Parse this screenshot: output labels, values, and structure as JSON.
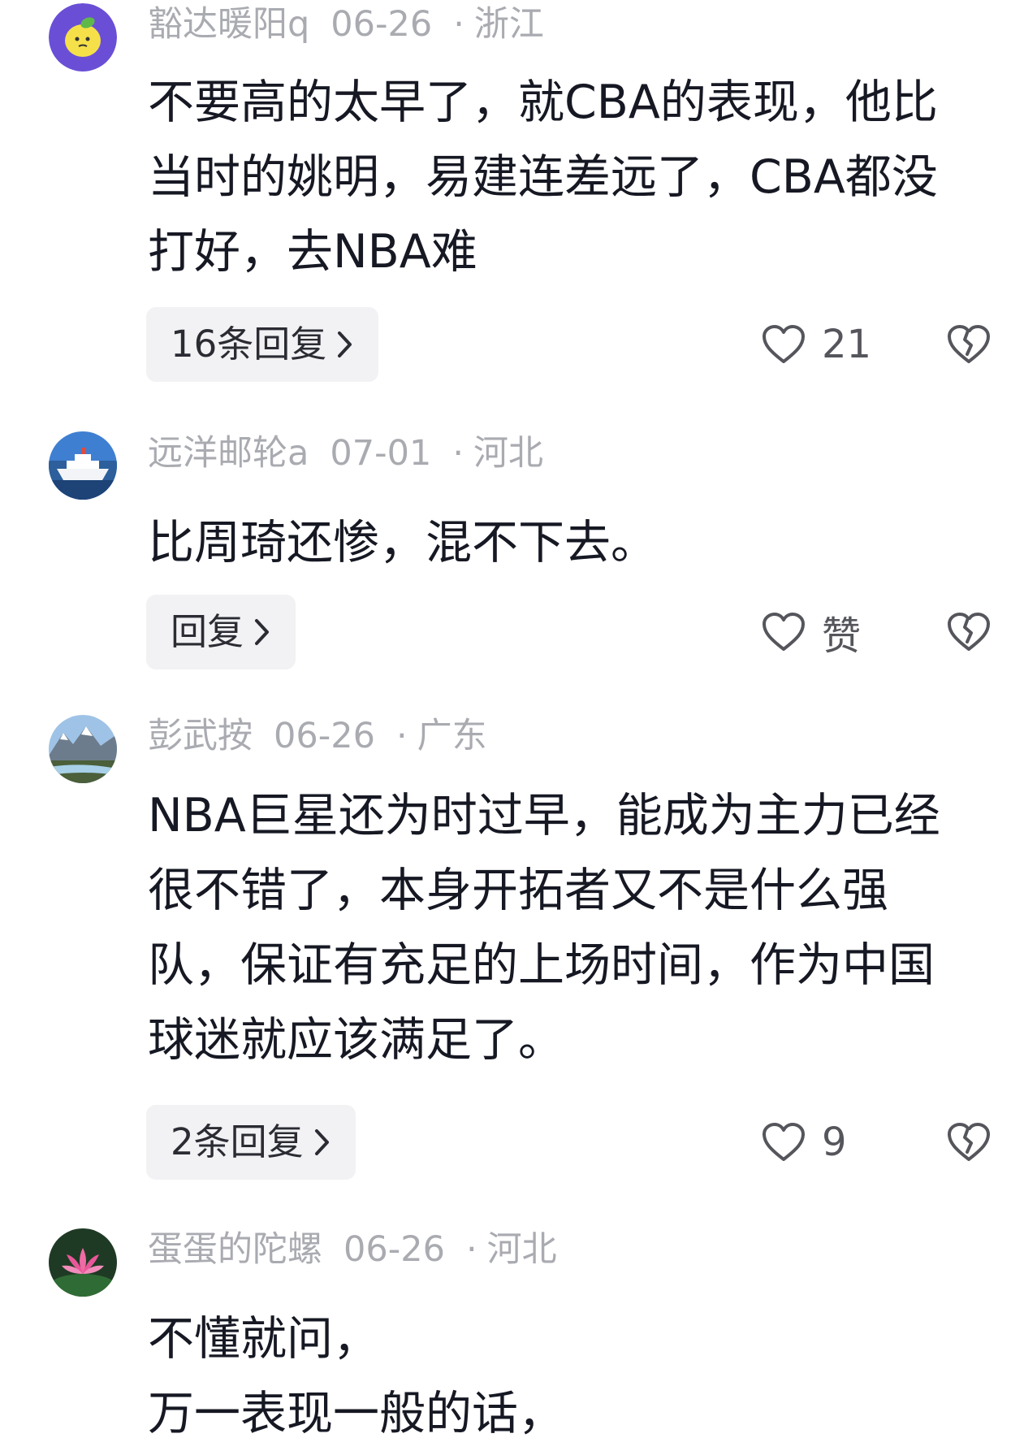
{
  "comments": [
    {
      "username": "豁达暖阳q",
      "date": "06-26",
      "separator": "·",
      "location": "浙江",
      "lines": [
        "不要高的太早了，就CBA的表现，他比",
        "当时的姚明，易建连差远了，CBA都没",
        "打好，去NBA难"
      ],
      "reply_label": "16条回复",
      "like_count": "21",
      "avatar_icon": "lemon-avatar"
    },
    {
      "username": "远洋邮轮a",
      "date": "07-01",
      "separator": "·",
      "location": "河北",
      "lines": [
        "比周琦还惨，混不下去。"
      ],
      "reply_label": "回复",
      "like_count": "赞",
      "avatar_icon": "cruise-ship-avatar"
    },
    {
      "username": "彭武按",
      "date": "06-26",
      "separator": "·",
      "location": "广东",
      "lines": [
        "NBA巨星还为时过早，能成为主力已经",
        "很不错了，本身开拓者又不是什么强",
        "队，保证有充足的上场时间，作为中国",
        "球迷就应该满足了。"
      ],
      "reply_label": "2条回复",
      "like_count": "9",
      "avatar_icon": "mountain-avatar"
    },
    {
      "username": "蛋蛋的陀螺",
      "date": "06-26",
      "separator": "·",
      "location": "河北",
      "lines": [
        "不懂就问，",
        "万一表现一般的话，"
      ],
      "avatar_icon": "lotus-avatar"
    }
  ],
  "colors": {
    "text": "#161823",
    "meta": "#a9abb1",
    "reply_bg": "#f2f2f4"
  }
}
